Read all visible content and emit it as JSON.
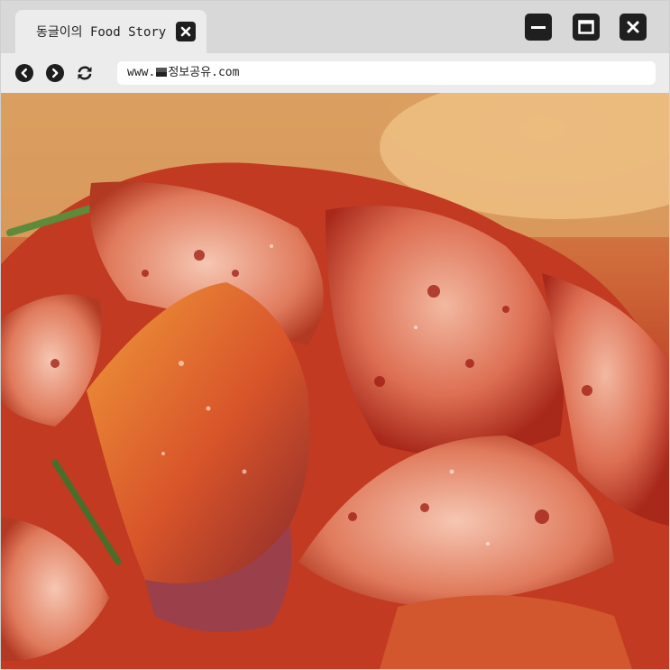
{
  "tab": {
    "title": "동글이의 Food Story"
  },
  "address_bar": {
    "prefix": "www.",
    "domain": "정보공유.com"
  },
  "icons": {
    "tab_close": "close-icon",
    "minimize": "minimize-icon",
    "maximize": "maximize-icon",
    "close": "close-icon",
    "back": "chevron-left-icon",
    "forward": "chevron-right-icon",
    "reload": "reload-icon",
    "site_flag": "flag-icon"
  },
  "colors": {
    "chrome": "#d8d8d8",
    "toolbar": "#ececec",
    "button": "#1f1f1f"
  }
}
